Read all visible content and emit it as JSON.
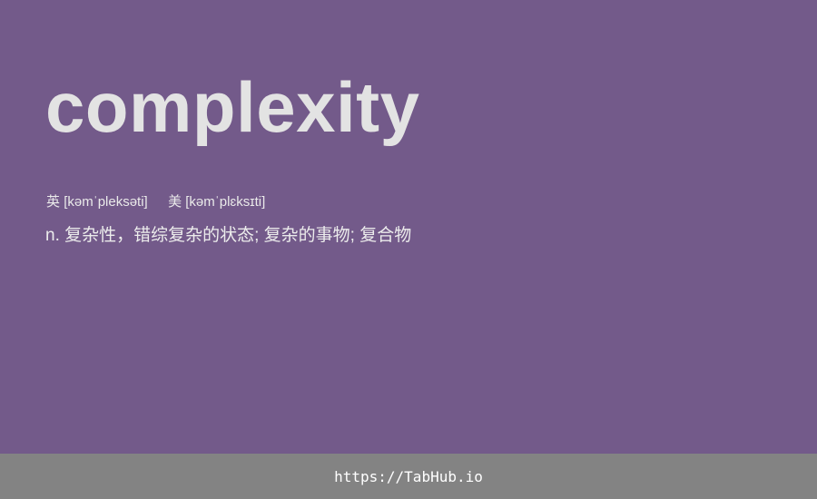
{
  "word": "complexity",
  "phonetics": {
    "uk_label": "英",
    "uk_ipa": "[kəmˈpleksəti]",
    "us_label": "美",
    "us_ipa": "[kəmˈplɛksɪti]"
  },
  "definition": "n. 复杂性，错综复杂的状态; 复杂的事物; 复合物",
  "footer": {
    "link_text": "https://TabHub.io"
  },
  "colors": {
    "background": "#735a8a",
    "footer_background": "#838383",
    "word_text": "#e3e3e3"
  }
}
